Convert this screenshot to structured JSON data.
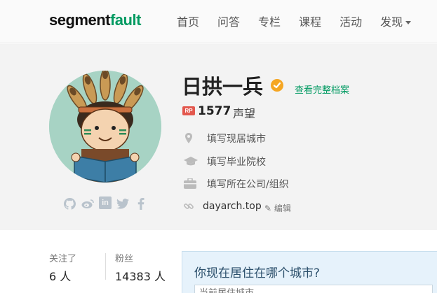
{
  "brand": {
    "logo_main": "segment",
    "logo_accent": "fault"
  },
  "nav": {
    "items": [
      "首页",
      "问答",
      "专栏",
      "课程",
      "活动",
      "发现"
    ]
  },
  "profile": {
    "name": "日拱一兵",
    "view_full_profile": "查看完整档案",
    "rp_badge": "RP",
    "reputation": "1577",
    "reputation_label": "声望",
    "city_placeholder": "填写现居城市",
    "school_placeholder": "填写毕业院校",
    "company_placeholder": "填写所在公司/组织",
    "website": "dayarch.top",
    "edit_label": "编辑"
  },
  "social": [
    "github-icon",
    "weibo-icon",
    "linkedin-icon",
    "twitter-icon",
    "facebook-icon"
  ],
  "stats": {
    "following_label": "关注了",
    "following_value": "6 人",
    "followers_label": "粉丝",
    "followers_value": "14383 人"
  },
  "city_prompt": {
    "title": "你现在居住在哪个城市?",
    "input_placeholder": "当前居住城市"
  },
  "colors": {
    "brand_green": "#009a61",
    "rp_red": "#e3584e",
    "verified_orange": "#f5a623"
  }
}
